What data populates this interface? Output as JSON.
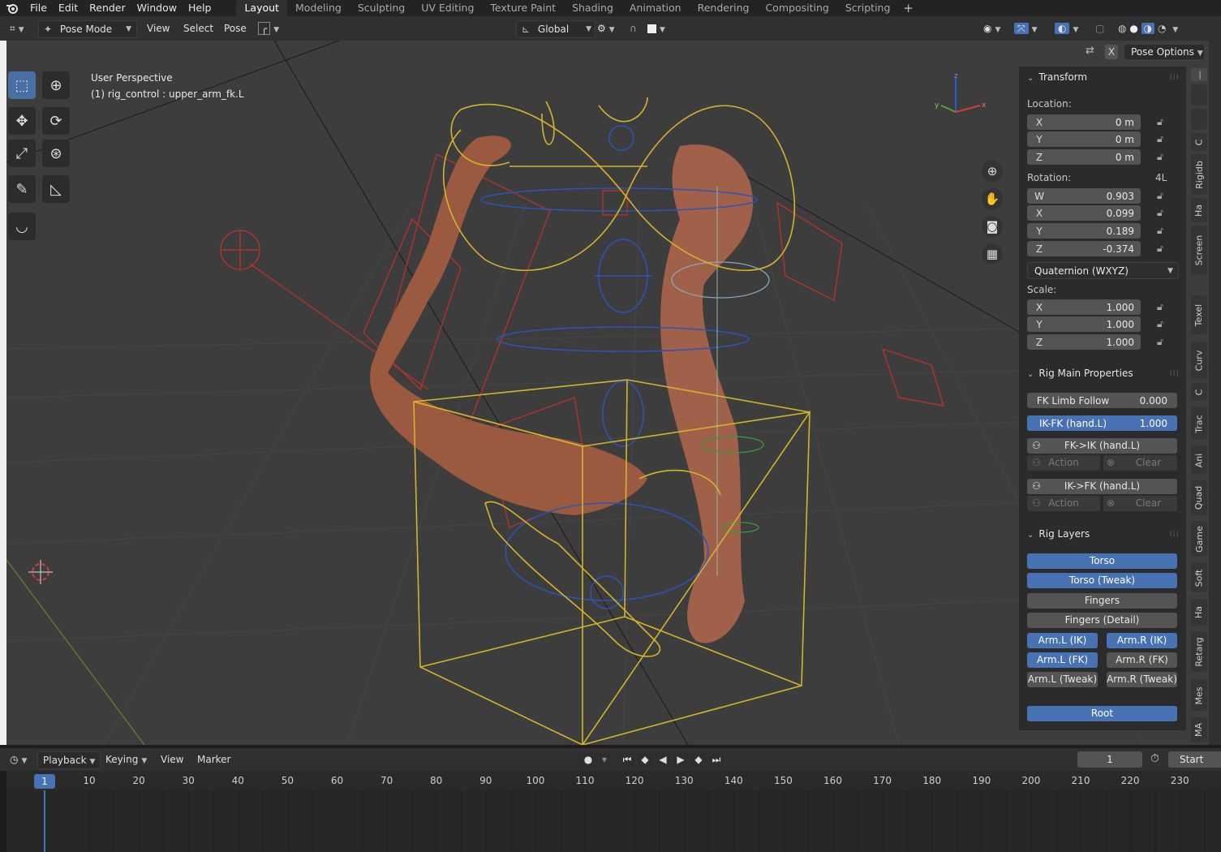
{
  "topbar": {
    "menus": [
      "File",
      "Edit",
      "Render",
      "Window",
      "Help"
    ],
    "workspaces": [
      "Layout",
      "Modeling",
      "Sculpting",
      "UV Editing",
      "Texture Paint",
      "Shading",
      "Animation",
      "Rendering",
      "Compositing",
      "Scripting"
    ],
    "active_workspace": "Layout",
    "add_tab": "+"
  },
  "viewport_header": {
    "mode": "Pose Mode",
    "menus": [
      "View",
      "Select",
      "Pose"
    ],
    "orientation": "Global",
    "pose_options": "Pose Options",
    "x_toggle": "X"
  },
  "viewport": {
    "perspective": "User Perspective",
    "active_object": "(1) rig_control : upper_arm_fk.L",
    "gizmo_axes": [
      "z",
      "y",
      "x"
    ]
  },
  "transform": {
    "title": "Transform",
    "location_label": "Location:",
    "location": [
      {
        "axis": "X",
        "value": "0 m"
      },
      {
        "axis": "Y",
        "value": "0 m"
      },
      {
        "axis": "Z",
        "value": "0 m"
      }
    ],
    "rotation_label": "Rotation:",
    "rotation_flag": "4L",
    "rotation": [
      {
        "axis": "W",
        "value": "0.903"
      },
      {
        "axis": "X",
        "value": "0.099"
      },
      {
        "axis": "Y",
        "value": "0.189"
      },
      {
        "axis": "Z",
        "value": "-0.374"
      }
    ],
    "rotation_mode": "Quaternion (WXYZ)",
    "scale_label": "Scale:",
    "scale": [
      {
        "axis": "X",
        "value": "1.000"
      },
      {
        "axis": "Y",
        "value": "1.000"
      },
      {
        "axis": "Z",
        "value": "1.000"
      }
    ]
  },
  "rig_main": {
    "title": "Rig Main Properties",
    "fk_follow_label": "FK Limb Follow",
    "fk_follow_value": "0.000",
    "ikfk_label": "IK-FK (hand.L)",
    "ikfk_value": "1.000",
    "fk_to_ik": "FK->IK (hand.L)",
    "ik_to_fk": "IK->FK (hand.L)",
    "action": "Action",
    "clear": "Clear"
  },
  "rig_layers": {
    "title": "Rig Layers",
    "torso": "Torso",
    "torso_tweak": "Torso (Tweak)",
    "fingers": "Fingers",
    "fingers_detail": "Fingers (Detail)",
    "arm_l_ik": "Arm.L (IK)",
    "arm_r_ik": "Arm.R (IK)",
    "arm_l_fk": "Arm.L (FK)",
    "arm_r_fk": "Arm.R (FK)",
    "arm_l_tweak": "Arm.L (Tweak)",
    "arm_r_tweak": "Arm.R (Tweak)",
    "root": "Root"
  },
  "side_tabs": [
    "C",
    "Rigidb",
    "Ha",
    "Screen",
    "Texel",
    "Curv",
    "C",
    "Trac",
    "Ani",
    "Quad",
    "Game",
    "Soft",
    "Ha",
    "Retarg",
    "Mes",
    "MA"
  ],
  "timeline": {
    "menus": [
      "Playback",
      "Keying",
      "View",
      "Marker"
    ],
    "current_frame": "1",
    "start_label": "Start",
    "ticks": [
      "10",
      "20",
      "30",
      "40",
      "50",
      "60",
      "70",
      "80",
      "90",
      "100",
      "110",
      "120",
      "130",
      "140",
      "150",
      "160",
      "170",
      "180",
      "190",
      "200",
      "210",
      "220",
      "230"
    ]
  },
  "colors": {
    "accent_blue": "#4772b3",
    "panel_bg": "#2b2b2b",
    "viewport_bg": "#3d3d3d",
    "rig_yellow": "#d4b32a",
    "rig_red": "#b3322b",
    "rig_blue": "#2b55b8"
  }
}
